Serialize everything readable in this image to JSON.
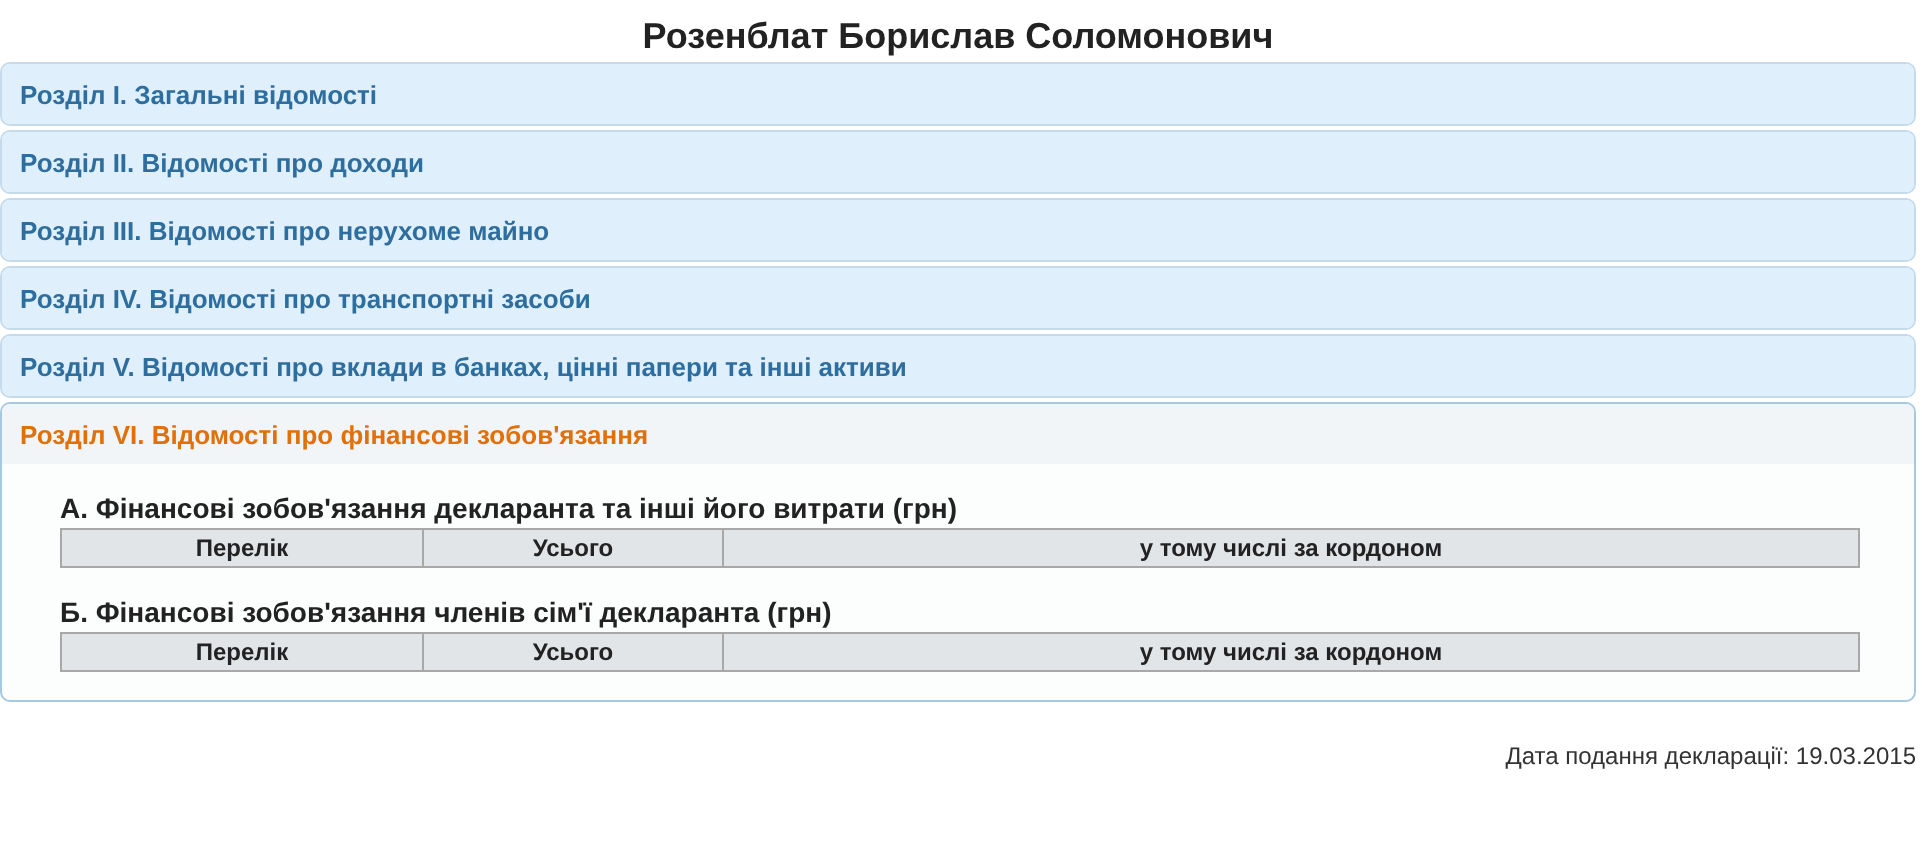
{
  "title": "Розенблат Борислав Соломонович",
  "sections": [
    {
      "title": "Розділ I. Загальні відомості",
      "expanded": false
    },
    {
      "title": "Розділ II. Відомості про доходи",
      "expanded": false
    },
    {
      "title": "Розділ III. Відомості про нерухоме майно",
      "expanded": false
    },
    {
      "title": "Розділ IV. Відомості про транспортні засоби",
      "expanded": false
    },
    {
      "title": "Розділ V. Відомості про вклади в банках, цінні папери та інші активи",
      "expanded": false
    },
    {
      "title": "Розділ VI. Відомості про фінансові зобов'язання",
      "expanded": true,
      "subsections": [
        {
          "title": "А. Фінансові зобов'язання декларанта та інші його витрати (грн)",
          "columns": [
            "Перелік",
            "Усього",
            "у тому числі за кордоном"
          ]
        },
        {
          "title": "Б. Фінансові зобов'язання членів сім'ї декларанта (грн)",
          "columns": [
            "Перелік",
            "Усього",
            "у тому числі за кордоном"
          ]
        }
      ]
    }
  ],
  "footer": "Дата подання декларації: 19.03.2015"
}
